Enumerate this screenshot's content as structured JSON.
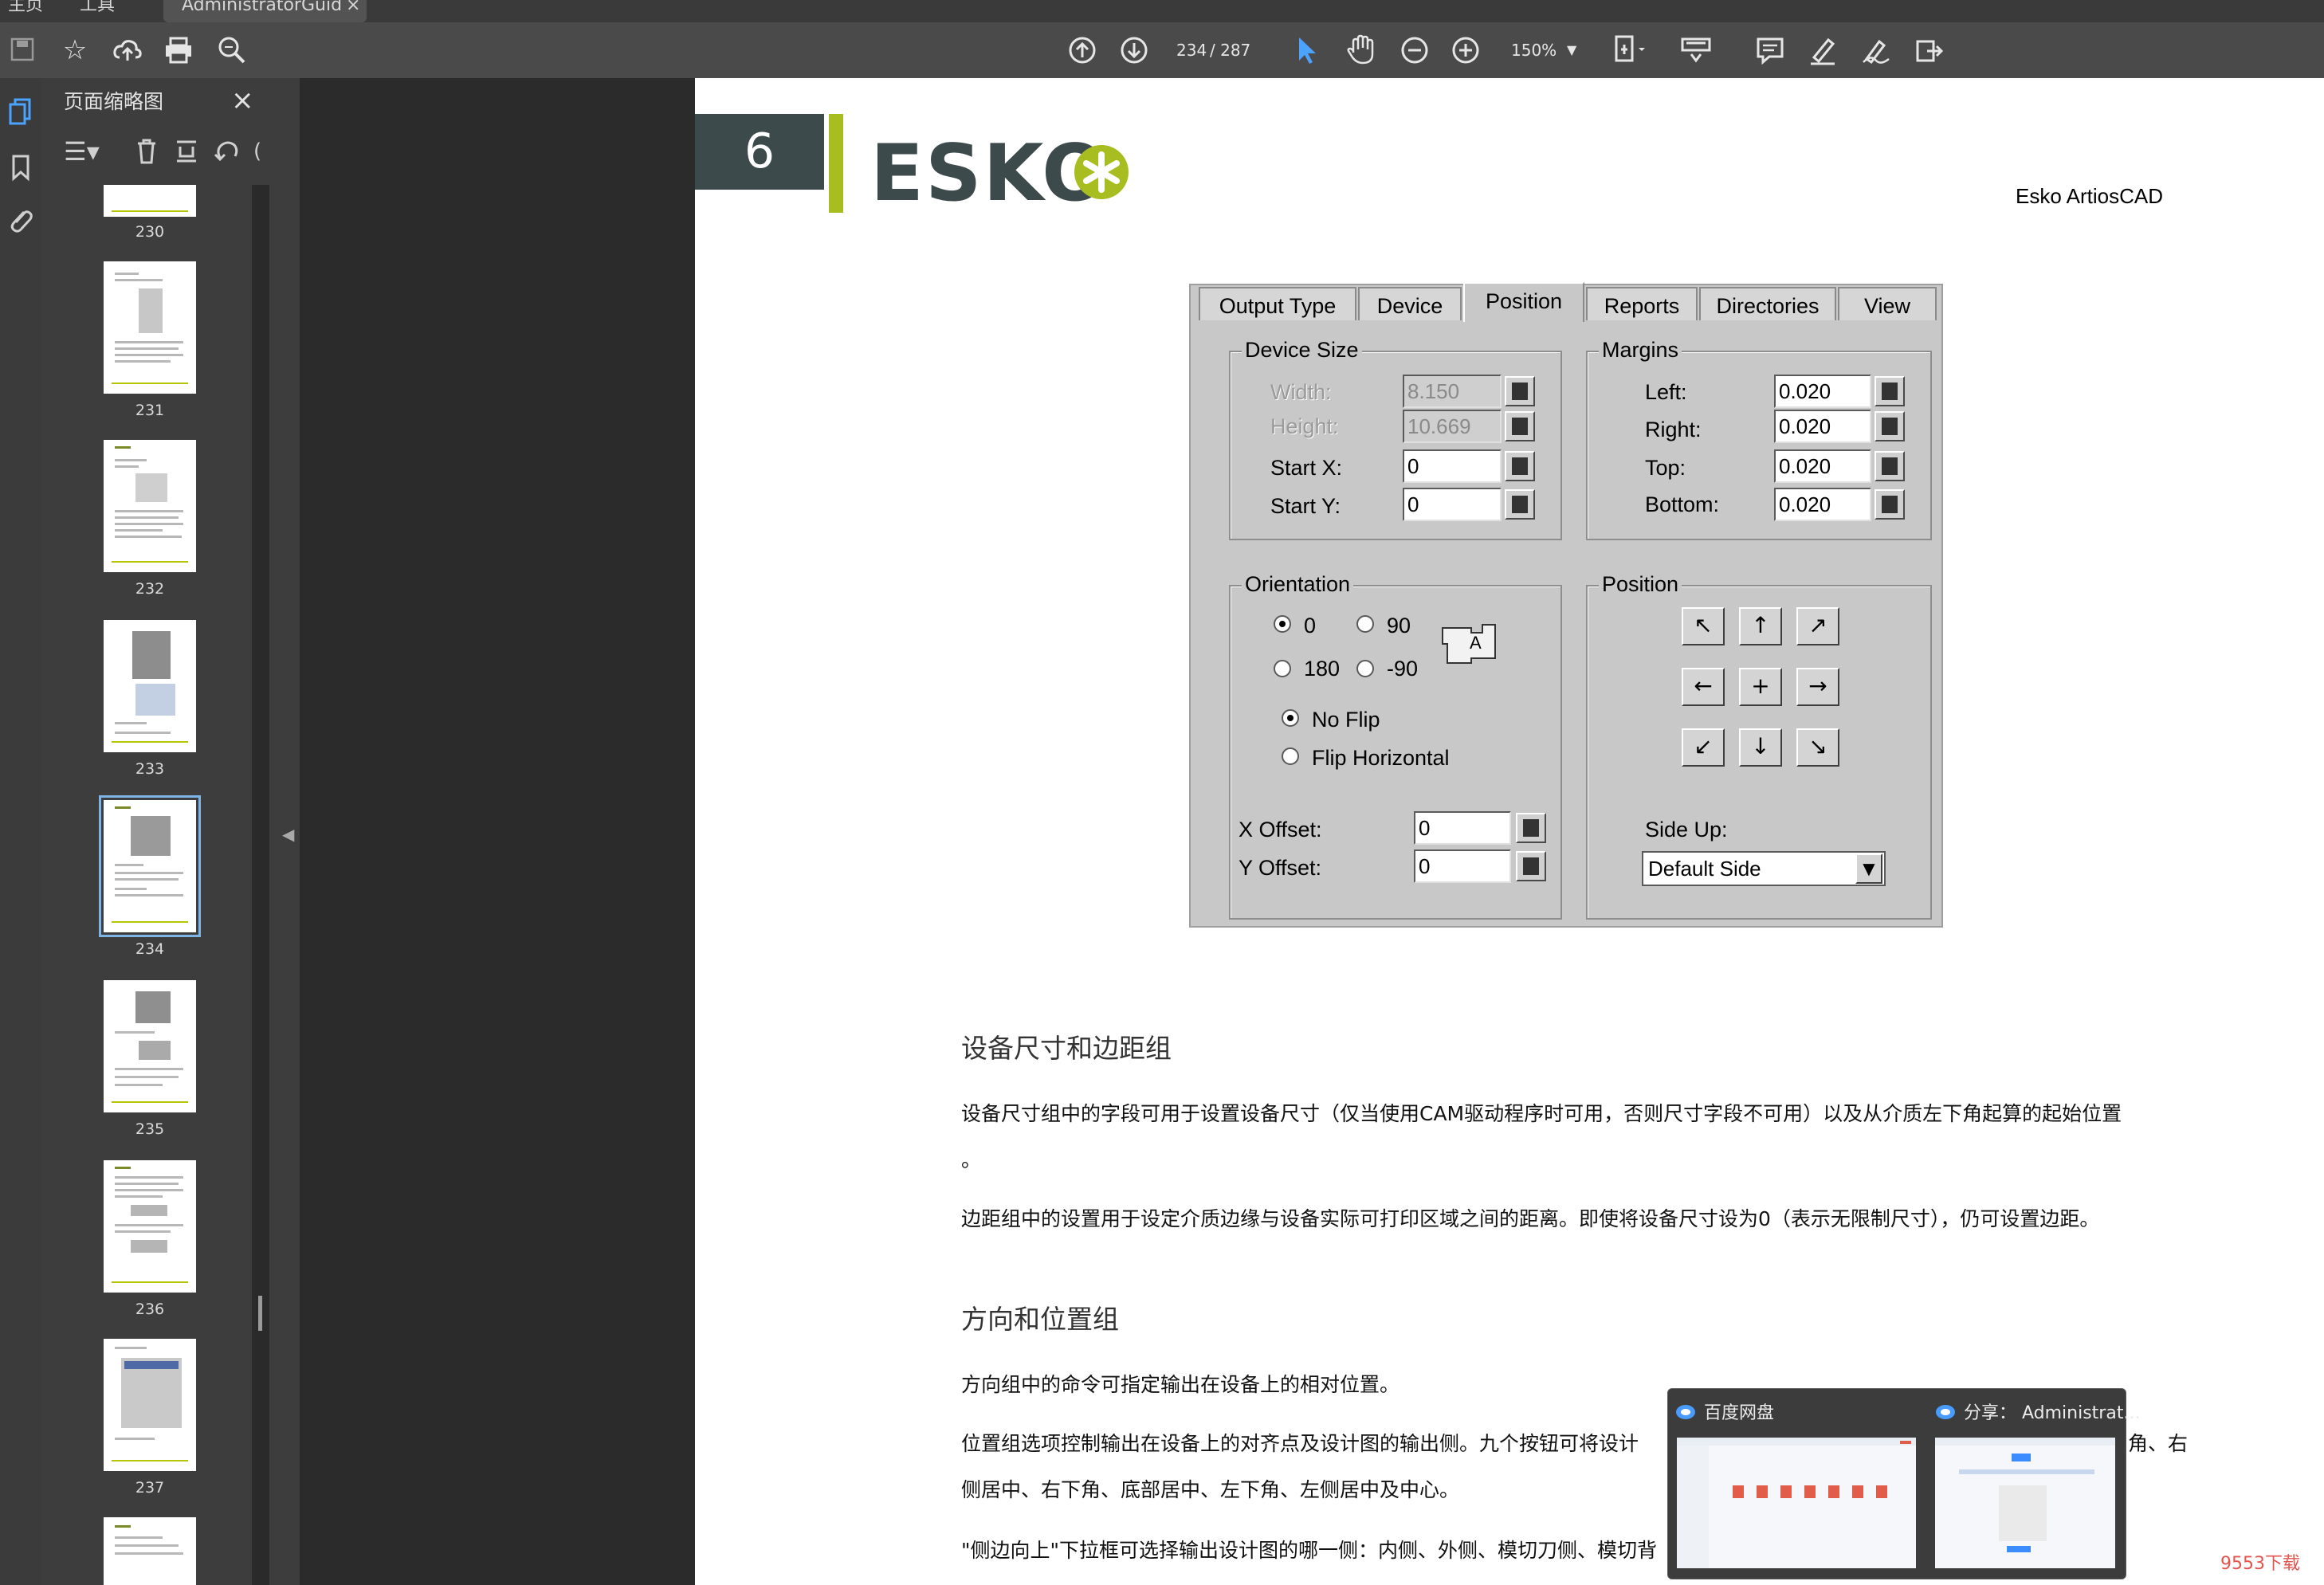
{
  "tabbar": {
    "home": "主页",
    "tools": "工具",
    "doc_tab": "AdministratorGuide...",
    "doc_tab_close": "×"
  },
  "toolbar": {
    "save_icon": "save-icon",
    "bookmark_icon": "star-icon",
    "upload_icon": "upload-icon",
    "print_icon": "print-icon",
    "search_icon": "zoom-search-icon",
    "prev_icon": "page-up-icon",
    "next_icon": "page-down-icon",
    "page_current": "234",
    "page_total": "/ 287",
    "zoom_value": "150%"
  },
  "panel": {
    "title": "页面缩略图",
    "close": "×"
  },
  "thumbnails": [
    {
      "label": "230"
    },
    {
      "label": "231"
    },
    {
      "label": "232"
    },
    {
      "label": "233"
    },
    {
      "label": "234"
    },
    {
      "label": "235"
    },
    {
      "label": "236"
    },
    {
      "label": "237"
    }
  ],
  "page": {
    "chapter": "6",
    "logo": "ESKO",
    "header_right": "Esko ArtiosCAD"
  },
  "dialog": {
    "tabs": [
      "Output Type",
      "Device",
      "Position",
      "Reports",
      "Directories",
      "View"
    ],
    "device_size": {
      "title": "Device Size",
      "width_label": "Width:",
      "width_value": "8.150",
      "height_label": "Height:",
      "height_value": "10.669",
      "startx_label": "Start X:",
      "startx_value": "0",
      "starty_label": "Start Y:",
      "starty_value": "0"
    },
    "margins": {
      "title": "Margins",
      "left_label": "Left:",
      "left_value": "0.020",
      "right_label": "Right:",
      "right_value": "0.020",
      "top_label": "Top:",
      "top_value": "0.020",
      "bottom_label": "Bottom:",
      "bottom_value": "0.020"
    },
    "orientation": {
      "title": "Orientation",
      "opt_0": "0",
      "opt_90": "90",
      "opt_180": "180",
      "opt_m90": "-90",
      "no_flip": "No Flip",
      "flip_h": "Flip Horizontal",
      "xoffset_label": "X Offset:",
      "xoffset_value": "0",
      "yoffset_label": "Y Offset:",
      "yoffset_value": "0"
    },
    "position": {
      "title": "Position",
      "sideup_label": "Side Up:",
      "sideup_value": "Default Side"
    }
  },
  "text": {
    "h1": "设备尺寸和边距组",
    "p1a": "设备尺寸组中的字段可用于设置设备尺寸（仅当使用CAM驱动程序时可用，否则尺寸字段不可用）以及从介质左下角起算的起始位置",
    "p1b": "。",
    "p2": "边距组中的设置用于设定介质边缘与设备实际可打印区域之间的距离。即使将设备尺寸设为0（表示无限制尺寸），仍可设置边距。",
    "h2": "方向和位置组",
    "p3": "方向组中的命令可指定输出在设备上的相对位置。",
    "p4a": "位置组选项控制输出在设备上的对齐点及设计图的输出侧。九个按钮可将设计",
    "p4a_end": "角、右",
    "p4b": "侧居中、右下角、底部居中、左下角、左侧居中及中心。",
    "p5": "\"侧边向上\"下拉框可选择输出设计图的哪一侧：内侧、外侧、模切刀侧、模切背"
  },
  "popup": {
    "title1": "百度网盘",
    "title2": "分享：  Administrat..."
  },
  "watermark": "9553下载"
}
